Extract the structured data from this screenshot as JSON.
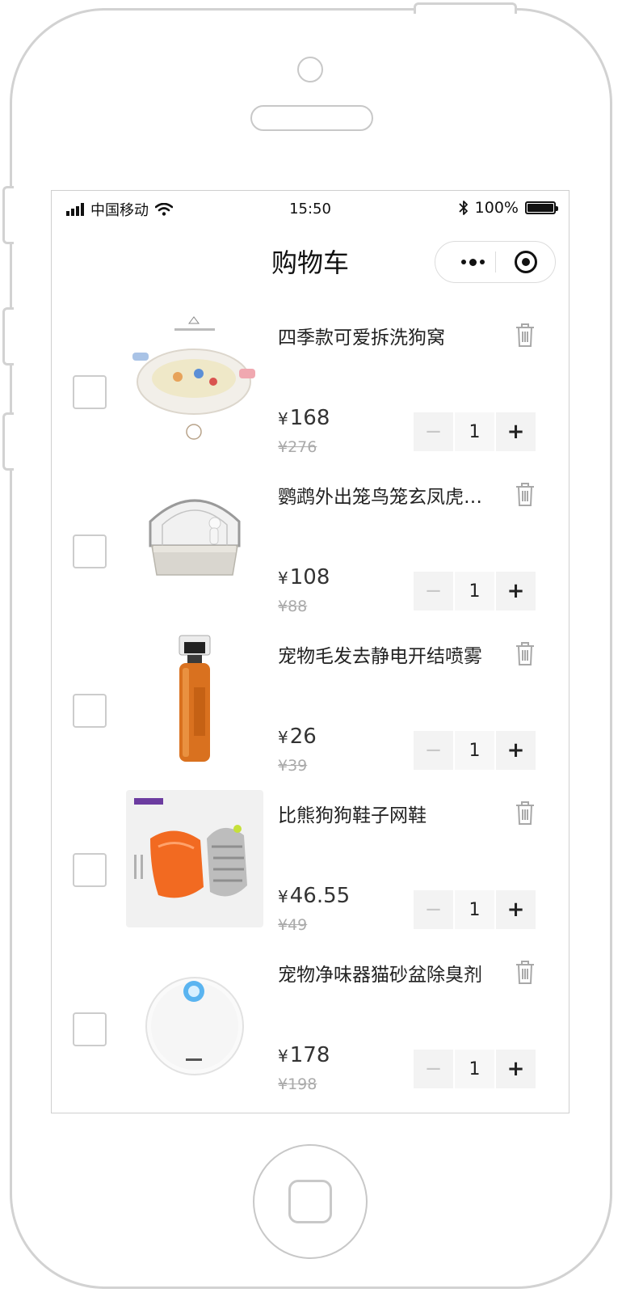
{
  "status_bar": {
    "carrier": "中国移动",
    "time": "15:50",
    "battery": "100%"
  },
  "navbar": {
    "title": "购物车"
  },
  "cart": {
    "items": [
      {
        "name": "四季款可爱拆洗狗窝",
        "price": "168",
        "original_price": "¥276",
        "quantity": "1",
        "checked": false,
        "image": "dog-bed"
      },
      {
        "name": "鹦鹉外出笼鸟笼玄凤虎…",
        "price": "108",
        "original_price": "¥88",
        "quantity": "1",
        "checked": false,
        "image": "bird-cage"
      },
      {
        "name": "宠物毛发去静电开结喷雾",
        "price": "26",
        "original_price": "¥39",
        "quantity": "1",
        "checked": false,
        "image": "spray-bottle"
      },
      {
        "name": "比熊狗狗鞋子网鞋",
        "price": "46.55",
        "original_price": "¥49",
        "quantity": "1",
        "checked": false,
        "image": "dog-shoes"
      },
      {
        "name": "宠物净味器猫砂盆除臭剂",
        "price": "178",
        "original_price": "¥198",
        "quantity": "1",
        "checked": false,
        "image": "deodorizer"
      }
    ],
    "currency_symbol": "¥",
    "minus_label": "−",
    "plus_label": "+"
  },
  "colors": {
    "frame": "#d2d2d2",
    "stepper_bg": "#f3f3f3",
    "strike_price": "#aaaaaa"
  }
}
